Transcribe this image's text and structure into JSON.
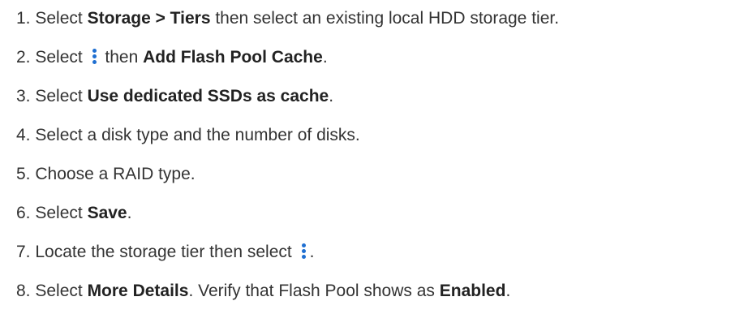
{
  "steps": [
    {
      "num": "1.",
      "a": "Select ",
      "b1": "Storage > Tiers",
      "c": " then select an existing local HDD storage tier."
    },
    {
      "num": "2.",
      "a": "Select ",
      "icon": "kebab-menu-icon",
      "c": " then ",
      "b1": "Add Flash Pool Cache",
      "d": "."
    },
    {
      "num": "3.",
      "a": "Select ",
      "b1": "Use dedicated SSDs as cache",
      "d": "."
    },
    {
      "num": "4.",
      "a": "Select a disk type and the number of disks."
    },
    {
      "num": "5.",
      "a": "Choose a RAID type."
    },
    {
      "num": "6.",
      "a": "Select ",
      "b1": "Save",
      "d": "."
    },
    {
      "num": "7.",
      "a": "Locate the storage tier then select ",
      "icon": "kebab-menu-icon",
      "d": "."
    },
    {
      "num": "8.",
      "a": "Select ",
      "b1": "More Details",
      "c": ". Verify that Flash Pool shows as ",
      "b2": "Enabled",
      "d": "."
    }
  ],
  "colors": {
    "text": "#333333",
    "bold_text": "#222222",
    "icon": "#1f6fd1"
  }
}
